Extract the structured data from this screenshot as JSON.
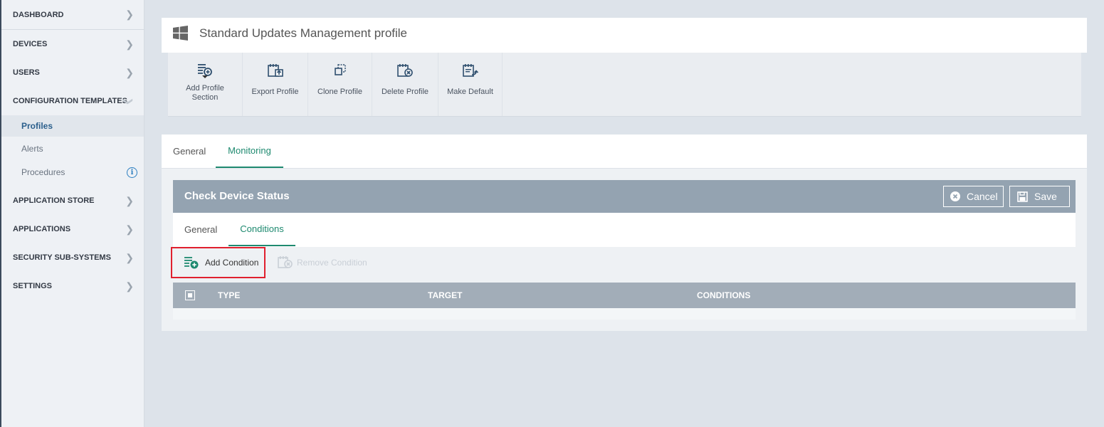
{
  "sidebar": {
    "items": [
      {
        "label": "DASHBOARD"
      },
      {
        "label": "DEVICES"
      },
      {
        "label": "USERS"
      },
      {
        "label": "CONFIGURATION TEMPLATES"
      },
      {
        "label": "APPLICATION STORE"
      },
      {
        "label": "APPLICATIONS"
      },
      {
        "label": "SECURITY SUB-SYSTEMS"
      },
      {
        "label": "SETTINGS"
      }
    ],
    "subitems": [
      {
        "label": "Profiles",
        "active": true
      },
      {
        "label": "Alerts"
      },
      {
        "label": "Procedures"
      }
    ]
  },
  "header": {
    "icon": "windows-icon",
    "title": "Standard Updates Management profile"
  },
  "toolbar": {
    "add_profile_section": "Add Profile Section",
    "export_profile": "Export Profile",
    "clone_profile": "Clone Profile",
    "delete_profile": "Delete Profile",
    "make_default": "Make Default"
  },
  "tabs": {
    "general": "General",
    "monitoring": "Monitoring",
    "active": "Monitoring"
  },
  "panel": {
    "title": "Check Device Status",
    "cancel_label": "Cancel",
    "save_label": "Save"
  },
  "subtabs": {
    "general": "General",
    "conditions": "Conditions",
    "active": "Conditions"
  },
  "actions": {
    "add_condition": "Add Condition",
    "remove_condition": "Remove Condition"
  },
  "grid": {
    "columns": [
      "TYPE",
      "TARGET",
      "CONDITIONS"
    ],
    "rows": []
  },
  "colors": {
    "accent": "#1f8a70",
    "panel_header": "#94a3b1",
    "highlight": "#e0202e",
    "info": "#2d7fc1"
  }
}
